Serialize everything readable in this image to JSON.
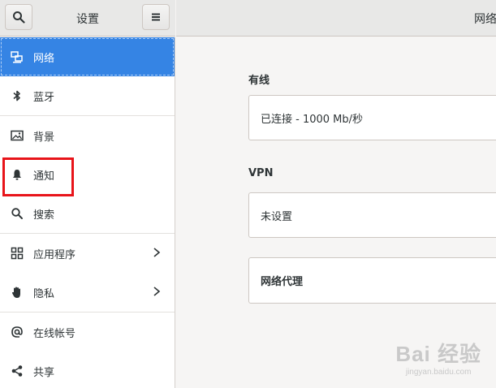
{
  "header": {
    "sidebar_title": "设置",
    "main_title": "网络"
  },
  "sidebar": {
    "items": [
      {
        "label": "网络",
        "icon": "network-icon",
        "active": true
      },
      {
        "label": "蓝牙",
        "icon": "bluetooth-icon"
      },
      {
        "label": "背景",
        "icon": "image-icon"
      },
      {
        "label": "通知",
        "icon": "bell-icon"
      },
      {
        "label": "搜索",
        "icon": "search-icon"
      },
      {
        "label": "应用程序",
        "icon": "apps-grid-icon",
        "chevron": true
      },
      {
        "label": "隐私",
        "icon": "hand-icon",
        "chevron": true
      },
      {
        "label": "在线帐号",
        "icon": "at-icon"
      },
      {
        "label": "共享",
        "icon": "share-icon"
      }
    ]
  },
  "main": {
    "wired_title": "有线",
    "wired_status": "已连接 - 1000 Mb/秒",
    "vpn_title": "VPN",
    "vpn_status": "未设置",
    "proxy_label": "网络代理"
  },
  "watermark": {
    "brand": "Bai 经验",
    "url": "jingyan.baidu.com"
  },
  "colors": {
    "accent": "#3584e4",
    "highlight": "#e8141a"
  }
}
